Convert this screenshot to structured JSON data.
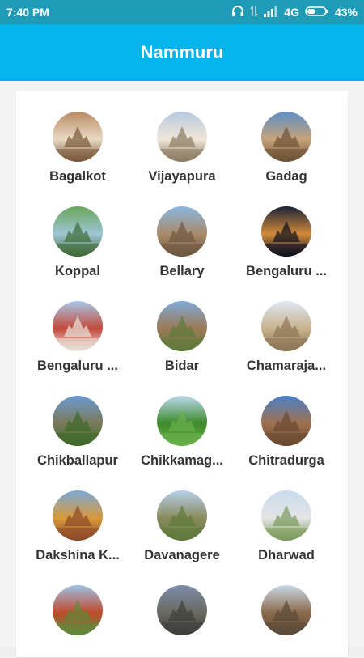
{
  "status_bar": {
    "time": "7:40 PM",
    "network": "4G",
    "battery": "43%"
  },
  "app_bar": {
    "title": "Nammuru"
  },
  "districts": [
    {
      "name": "Bagalkot",
      "icon": "temple-photo-icon"
    },
    {
      "name": "Vijayapura",
      "icon": "dome-monument-photo-icon"
    },
    {
      "name": "Gadag",
      "icon": "temple-ruins-photo-icon"
    },
    {
      "name": "Koppal",
      "icon": "lake-photo-icon"
    },
    {
      "name": "Bellary",
      "icon": "stone-pavilion-photo-icon"
    },
    {
      "name": "Bengaluru ...",
      "icon": "night-city-photo-icon"
    },
    {
      "name": "Bengaluru ...",
      "icon": "government-building-photo-icon"
    },
    {
      "name": "Bidar",
      "icon": "fort-garden-photo-icon"
    },
    {
      "name": "Chamaraja...",
      "icon": "temple-tower-photo-icon"
    },
    {
      "name": "Chikballapur",
      "icon": "hill-photo-icon"
    },
    {
      "name": "Chikkamag...",
      "icon": "green-hills-photo-icon"
    },
    {
      "name": "Chitradurga",
      "icon": "stone-temple-photo-icon"
    },
    {
      "name": "Dakshina K...",
      "icon": "gopuram-photo-icon"
    },
    {
      "name": "Davanagere",
      "icon": "temple-tank-photo-icon"
    },
    {
      "name": "Dharwad",
      "icon": "white-palace-photo-icon"
    },
    {
      "name": "",
      "icon": "clock-tower-photo-icon"
    },
    {
      "name": "",
      "icon": "ruined-structure-photo-icon"
    },
    {
      "name": "",
      "icon": "ancient-temple-photo-icon"
    }
  ]
}
